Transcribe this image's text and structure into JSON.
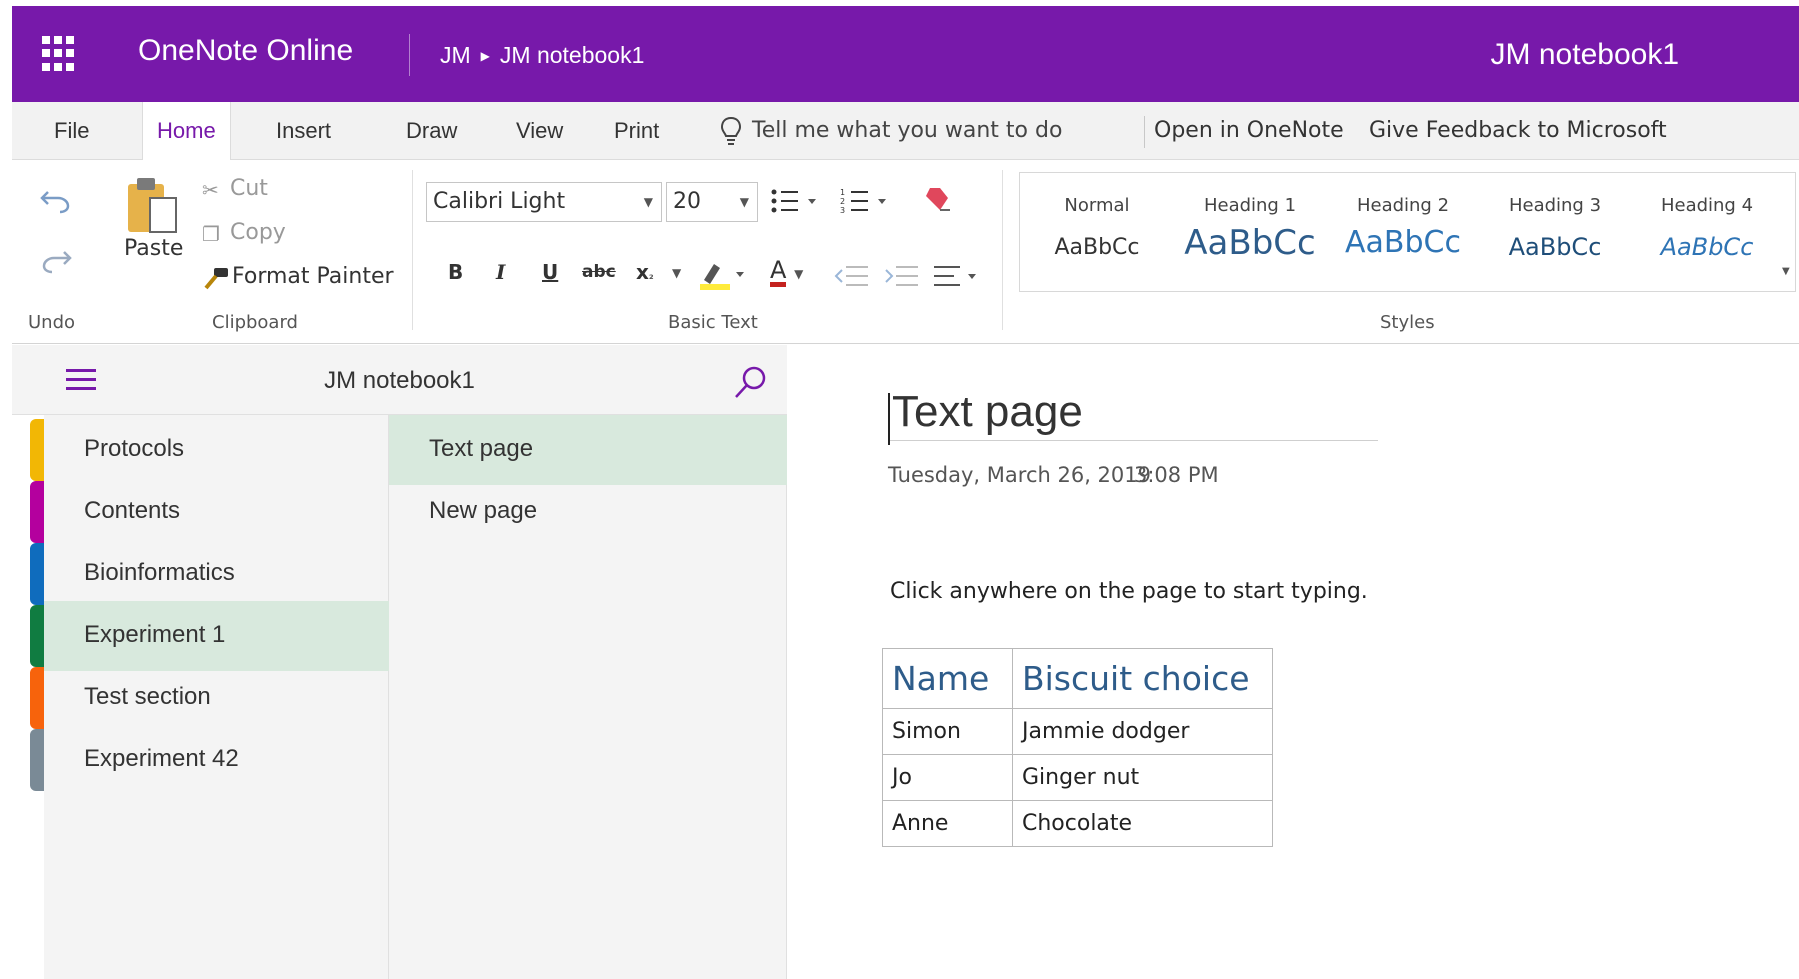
{
  "app": {
    "name": "OneNote Online",
    "notebook_title": "JM notebook1"
  },
  "breadcrumb": {
    "owner": "JM",
    "notebook": "JM notebook1"
  },
  "tabs": [
    {
      "label": "File"
    },
    {
      "label": "Home"
    },
    {
      "label": "Insert"
    },
    {
      "label": "Draw"
    },
    {
      "label": "View"
    },
    {
      "label": "Print"
    }
  ],
  "tell_me": "Tell me what you want to do",
  "links": {
    "open_in_onenote": "Open in OneNote",
    "feedback": "Give Feedback to Microsoft"
  },
  "ribbon": {
    "groups": {
      "undo": "Undo",
      "clipboard": "Clipboard",
      "basic_text": "Basic Text",
      "styles": "Styles"
    },
    "clipboard": {
      "paste": "Paste",
      "cut": "Cut",
      "copy": "Copy",
      "format_painter": "Format Painter"
    },
    "font_name": "Calibri Light",
    "font_size": "20",
    "format": {
      "bold": "B",
      "italic": "I",
      "underline": "U",
      "strike": "abc",
      "subscript": "x",
      "font_color": "A"
    },
    "styles": [
      {
        "name": "Normal",
        "sample": "AaBbCc"
      },
      {
        "name": "Heading 1",
        "sample": "AaBbCc"
      },
      {
        "name": "Heading 2",
        "sample": "AaBbCc"
      },
      {
        "name": "Heading 3",
        "sample": "AaBbCc"
      },
      {
        "name": "Heading 4",
        "sample": "AaBbCc"
      }
    ]
  },
  "navigation": {
    "title": "JM notebook1",
    "sections": [
      {
        "label": "Protocols",
        "color": "#f2b705"
      },
      {
        "label": "Contents",
        "color": "#b4009e"
      },
      {
        "label": "Bioinformatics",
        "color": "#0f6cbd"
      },
      {
        "label": "Experiment 1",
        "color": "#107c41"
      },
      {
        "label": "Test section",
        "color": "#f7630c"
      },
      {
        "label": "Experiment 42",
        "color": "#7a8a96"
      }
    ],
    "selected_section": "Experiment 1",
    "pages": [
      {
        "label": "Text page"
      },
      {
        "label": "New page"
      }
    ],
    "selected_page": "Text page"
  },
  "page": {
    "title": "Text page",
    "date": "Tuesday, March 26, 2019",
    "time": "3:08 PM",
    "body": "Click anywhere on the page to start typing.",
    "table": {
      "headers": [
        "Name",
        "Biscuit choice"
      ],
      "rows": [
        [
          "Simon",
          "Jammie dodger"
        ],
        [
          "Jo",
          "Ginger nut"
        ],
        [
          "Anne",
          "Chocolate"
        ]
      ]
    }
  },
  "colors": {
    "brand": "#7719aa",
    "selected": "#d8e9dd",
    "heading": "#2e5c8a"
  }
}
